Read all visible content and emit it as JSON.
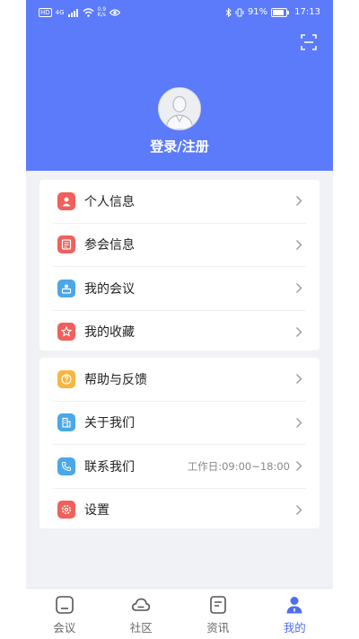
{
  "status_bar": {
    "hd": "HD",
    "network": "4G",
    "speed_value": "0.9",
    "speed_unit": "K/s",
    "battery": "91%",
    "time": "17:13"
  },
  "header": {
    "login_label": "登录/注册"
  },
  "menu_group_1": [
    {
      "label": "个人信息",
      "icon": "person-icon",
      "color": "#f0605c"
    },
    {
      "label": "参会信息",
      "icon": "badge-icon",
      "color": "#f0605c"
    },
    {
      "label": "我的会议",
      "icon": "meeting-icon",
      "color": "#4aa8e8"
    },
    {
      "label": "我的收藏",
      "icon": "star-icon",
      "color": "#f0605c"
    }
  ],
  "menu_group_2": [
    {
      "label": "帮助与反馈",
      "icon": "help-icon",
      "color": "#f6b63f"
    },
    {
      "label": "关于我们",
      "icon": "building-icon",
      "color": "#4aa8e8"
    },
    {
      "label": "联系我们",
      "icon": "phone-icon",
      "color": "#4aa8e8",
      "extra": "工作日:09:00~18:00"
    },
    {
      "label": "设置",
      "icon": "gear-icon",
      "color": "#f0605c"
    }
  ],
  "tabbar": [
    {
      "label": "会议",
      "icon": "home-icon",
      "active": false
    },
    {
      "label": "社区",
      "icon": "cloud-icon",
      "active": false
    },
    {
      "label": "资讯",
      "icon": "news-icon",
      "active": false
    },
    {
      "label": "我的",
      "icon": "user-icon",
      "active": true
    }
  ],
  "colors": {
    "primary": "#5b7bfb",
    "active_tab": "#4e6ef2",
    "background": "#f1f2f6"
  }
}
